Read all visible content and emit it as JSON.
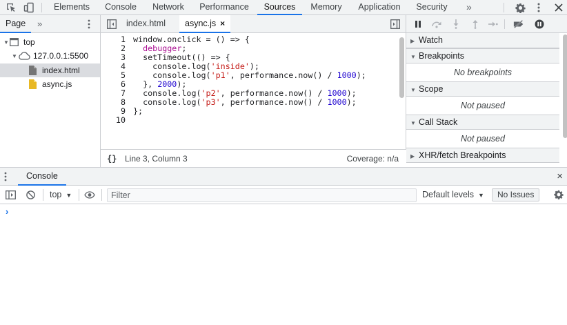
{
  "toolbar": {
    "tabs": [
      {
        "label": "Elements"
      },
      {
        "label": "Console"
      },
      {
        "label": "Network"
      },
      {
        "label": "Performance"
      },
      {
        "label": "Sources",
        "active": true
      },
      {
        "label": "Memory"
      },
      {
        "label": "Application"
      },
      {
        "label": "Security"
      }
    ],
    "more_label": "»"
  },
  "navigator": {
    "tab_label": "Page",
    "more_label": "»",
    "tree": {
      "top": "top",
      "host": "127.0.0.1:5500",
      "files": [
        {
          "name": "index.html",
          "selected": true
        },
        {
          "name": "async.js",
          "selected": false
        }
      ]
    }
  },
  "editor": {
    "tabs": [
      {
        "label": "index.html"
      },
      {
        "label": "async.js",
        "active": true,
        "close": "×"
      }
    ],
    "line_numbers": [
      "1",
      "2",
      "3",
      "4",
      "5",
      "6",
      "7",
      "8",
      "9",
      "10"
    ],
    "status": {
      "braces": "{}",
      "position": "Line 3, Column 3",
      "coverage": "Coverage: n/a"
    }
  },
  "debugger": {
    "sections": [
      {
        "title": "Watch"
      },
      {
        "title": "Breakpoints",
        "body": "No breakpoints"
      },
      {
        "title": "Scope",
        "body": "Not paused"
      },
      {
        "title": "Call Stack",
        "body": "Not paused"
      },
      {
        "title": "XHR/fetch Breakpoints"
      }
    ]
  },
  "drawer": {
    "tab_label": "Console",
    "close": "×"
  },
  "console": {
    "context": "top",
    "filter_placeholder": "Filter",
    "levels": "Default levels",
    "issues": "No Issues",
    "prompt": "›"
  },
  "colors": {
    "accent": "#1a73e8",
    "keyword": "#a90d91",
    "string": "#c41a16",
    "number": "#1c00cf",
    "file_icon_gray": "#757575",
    "file_icon_js": "#e8b824"
  },
  "icons": [
    "inspect-icon",
    "device-icon",
    "gear-icon",
    "kebab-icon",
    "close-icon",
    "sidebar-toggle-icon",
    "pause-icon",
    "step-over-icon",
    "step-into-icon",
    "step-out-icon",
    "step-icon",
    "deactivate-breakpoints-icon",
    "pause-on-exceptions-icon",
    "cloud-icon",
    "file-icon",
    "clear-icon",
    "eye-icon"
  ]
}
